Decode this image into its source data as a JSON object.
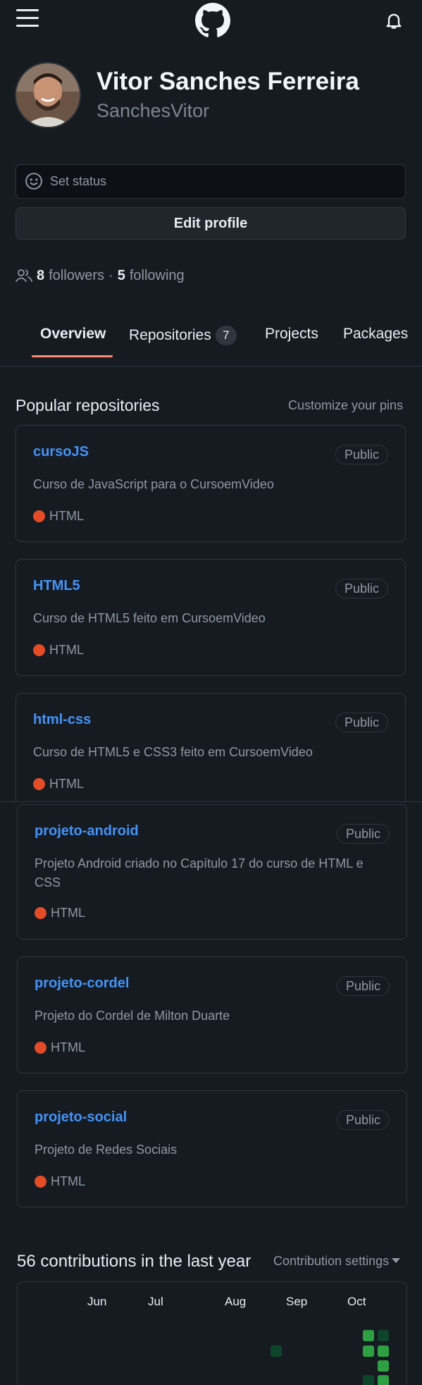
{
  "header": {
    "menu_icon": "hamburger-icon",
    "logo_icon": "github-logo-icon",
    "notification_icon": "bell-icon"
  },
  "profile": {
    "name": "Vitor Sanches Ferreira",
    "login": "SanchesVitor",
    "status_placeholder": "Set status",
    "edit_label": "Edit profile",
    "followers_count": "8",
    "followers_label": "followers",
    "separator": "·",
    "following_count": "5",
    "following_label": "following"
  },
  "tabs": [
    {
      "label": "Overview",
      "active": true
    },
    {
      "label": "Repositories",
      "count": "7"
    },
    {
      "label": "Projects"
    },
    {
      "label": "Packages"
    }
  ],
  "popular": {
    "title": "Popular repositories",
    "customize_label": "Customize your pins",
    "repos": [
      {
        "name": "cursoJS",
        "visibility": "Public",
        "description": "Curso de JavaScript para o CursoemVideo",
        "language": "HTML"
      },
      {
        "name": "HTML5",
        "visibility": "Public",
        "description": "Curso de HTML5 feito em CursoemVideo",
        "language": "HTML"
      },
      {
        "name": "html-css",
        "visibility": "Public",
        "description": "Curso de HTML5 e CSS3 feito em CursoemVideo",
        "language": "HTML"
      },
      {
        "name": "projeto-android",
        "visibility": "Public",
        "description": "Projeto Android criado no Capítulo 17 do curso de HTML e CSS",
        "language": "HTML"
      },
      {
        "name": "projeto-cordel",
        "visibility": "Public",
        "description": "Projeto do Cordel de Milton Duarte",
        "language": "HTML"
      },
      {
        "name": "projeto-social",
        "visibility": "Public",
        "description": "Projeto de Redes Sociais",
        "language": "HTML"
      }
    ]
  },
  "contributions": {
    "title": "56 contributions in the last year",
    "settings_label": "Contribution settings",
    "months": [
      "Jun",
      "Jul",
      "Aug",
      "Sep",
      "Oct"
    ]
  },
  "colors": {
    "background": "#161b22",
    "link": "#4493f8",
    "html_language": "#e34c26",
    "tab_underline": "#fd8c73",
    "contrib_high": "#2ea043",
    "contrib_low": "#0e4429"
  }
}
